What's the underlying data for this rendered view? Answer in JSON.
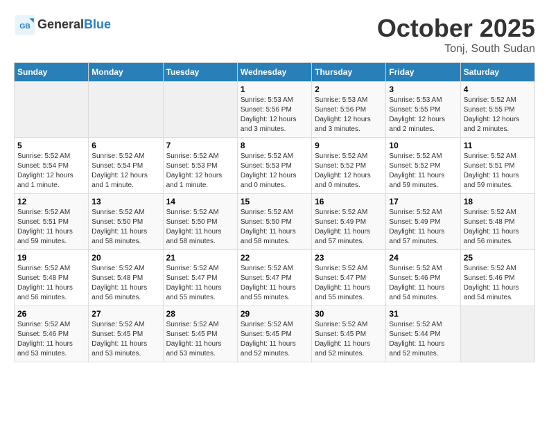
{
  "header": {
    "logo_general": "General",
    "logo_blue": "Blue",
    "month_title": "October 2025",
    "location": "Tonj, South Sudan"
  },
  "weekdays": [
    "Sunday",
    "Monday",
    "Tuesday",
    "Wednesday",
    "Thursday",
    "Friday",
    "Saturday"
  ],
  "weeks": [
    [
      {
        "day": "",
        "info": ""
      },
      {
        "day": "",
        "info": ""
      },
      {
        "day": "",
        "info": ""
      },
      {
        "day": "1",
        "info": "Sunrise: 5:53 AM\nSunset: 5:56 PM\nDaylight: 12 hours and 3 minutes."
      },
      {
        "day": "2",
        "info": "Sunrise: 5:53 AM\nSunset: 5:56 PM\nDaylight: 12 hours and 3 minutes."
      },
      {
        "day": "3",
        "info": "Sunrise: 5:53 AM\nSunset: 5:55 PM\nDaylight: 12 hours and 2 minutes."
      },
      {
        "day": "4",
        "info": "Sunrise: 5:52 AM\nSunset: 5:55 PM\nDaylight: 12 hours and 2 minutes."
      }
    ],
    [
      {
        "day": "5",
        "info": "Sunrise: 5:52 AM\nSunset: 5:54 PM\nDaylight: 12 hours and 1 minute."
      },
      {
        "day": "6",
        "info": "Sunrise: 5:52 AM\nSunset: 5:54 PM\nDaylight: 12 hours and 1 minute."
      },
      {
        "day": "7",
        "info": "Sunrise: 5:52 AM\nSunset: 5:53 PM\nDaylight: 12 hours and 1 minute."
      },
      {
        "day": "8",
        "info": "Sunrise: 5:52 AM\nSunset: 5:53 PM\nDaylight: 12 hours and 0 minutes."
      },
      {
        "day": "9",
        "info": "Sunrise: 5:52 AM\nSunset: 5:52 PM\nDaylight: 12 hours and 0 minutes."
      },
      {
        "day": "10",
        "info": "Sunrise: 5:52 AM\nSunset: 5:52 PM\nDaylight: 11 hours and 59 minutes."
      },
      {
        "day": "11",
        "info": "Sunrise: 5:52 AM\nSunset: 5:51 PM\nDaylight: 11 hours and 59 minutes."
      }
    ],
    [
      {
        "day": "12",
        "info": "Sunrise: 5:52 AM\nSunset: 5:51 PM\nDaylight: 11 hours and 59 minutes."
      },
      {
        "day": "13",
        "info": "Sunrise: 5:52 AM\nSunset: 5:50 PM\nDaylight: 11 hours and 58 minutes."
      },
      {
        "day": "14",
        "info": "Sunrise: 5:52 AM\nSunset: 5:50 PM\nDaylight: 11 hours and 58 minutes."
      },
      {
        "day": "15",
        "info": "Sunrise: 5:52 AM\nSunset: 5:50 PM\nDaylight: 11 hours and 58 minutes."
      },
      {
        "day": "16",
        "info": "Sunrise: 5:52 AM\nSunset: 5:49 PM\nDaylight: 11 hours and 57 minutes."
      },
      {
        "day": "17",
        "info": "Sunrise: 5:52 AM\nSunset: 5:49 PM\nDaylight: 11 hours and 57 minutes."
      },
      {
        "day": "18",
        "info": "Sunrise: 5:52 AM\nSunset: 5:48 PM\nDaylight: 11 hours and 56 minutes."
      }
    ],
    [
      {
        "day": "19",
        "info": "Sunrise: 5:52 AM\nSunset: 5:48 PM\nDaylight: 11 hours and 56 minutes."
      },
      {
        "day": "20",
        "info": "Sunrise: 5:52 AM\nSunset: 5:48 PM\nDaylight: 11 hours and 56 minutes."
      },
      {
        "day": "21",
        "info": "Sunrise: 5:52 AM\nSunset: 5:47 PM\nDaylight: 11 hours and 55 minutes."
      },
      {
        "day": "22",
        "info": "Sunrise: 5:52 AM\nSunset: 5:47 PM\nDaylight: 11 hours and 55 minutes."
      },
      {
        "day": "23",
        "info": "Sunrise: 5:52 AM\nSunset: 5:47 PM\nDaylight: 11 hours and 55 minutes."
      },
      {
        "day": "24",
        "info": "Sunrise: 5:52 AM\nSunset: 5:46 PM\nDaylight: 11 hours and 54 minutes."
      },
      {
        "day": "25",
        "info": "Sunrise: 5:52 AM\nSunset: 5:46 PM\nDaylight: 11 hours and 54 minutes."
      }
    ],
    [
      {
        "day": "26",
        "info": "Sunrise: 5:52 AM\nSunset: 5:46 PM\nDaylight: 11 hours and 53 minutes."
      },
      {
        "day": "27",
        "info": "Sunrise: 5:52 AM\nSunset: 5:45 PM\nDaylight: 11 hours and 53 minutes."
      },
      {
        "day": "28",
        "info": "Sunrise: 5:52 AM\nSunset: 5:45 PM\nDaylight: 11 hours and 53 minutes."
      },
      {
        "day": "29",
        "info": "Sunrise: 5:52 AM\nSunset: 5:45 PM\nDaylight: 11 hours and 52 minutes."
      },
      {
        "day": "30",
        "info": "Sunrise: 5:52 AM\nSunset: 5:45 PM\nDaylight: 11 hours and 52 minutes."
      },
      {
        "day": "31",
        "info": "Sunrise: 5:52 AM\nSunset: 5:44 PM\nDaylight: 11 hours and 52 minutes."
      },
      {
        "day": "",
        "info": ""
      }
    ]
  ]
}
